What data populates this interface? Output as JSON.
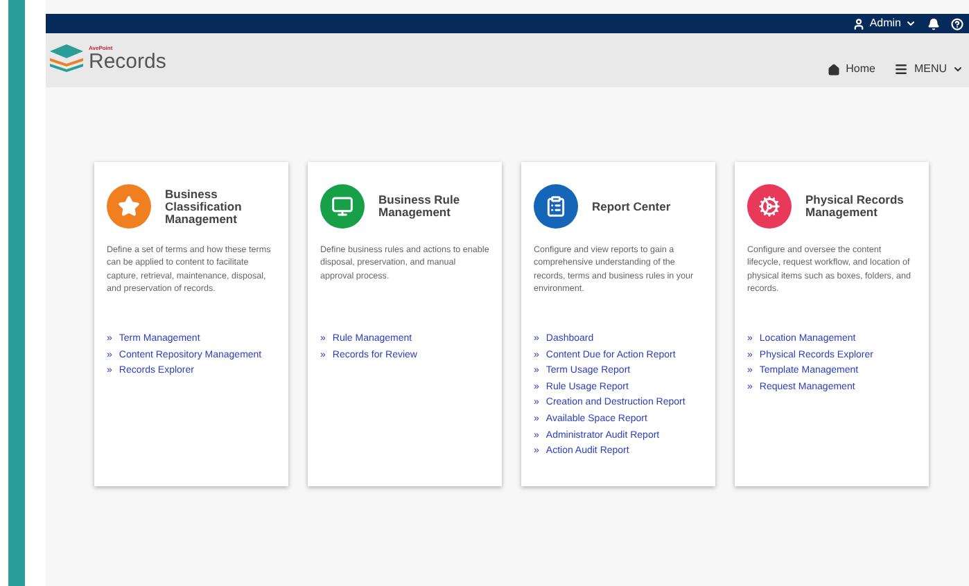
{
  "top_bar": {
    "user": "Admin"
  },
  "header": {
    "brand": "AvePoint",
    "product": "Records",
    "nav": [
      {
        "label": "Home"
      },
      {
        "label": "MENU"
      }
    ]
  },
  "cards": [
    {
      "title": "Business Classification Management",
      "color": "#f07f22",
      "description": "Define a set of terms and how these terms can be applied to content to facilitate capture, retrieval, maintenance, disposal, and preservation of records.",
      "links": [
        {
          "marker": "»",
          "label": "Term Management"
        },
        {
          "marker": "»",
          "label": "Content Repository Management"
        },
        {
          "marker": "»",
          "label": "Records Explorer"
        }
      ]
    },
    {
      "title": "Business Rule Management",
      "color": "#18a048",
      "description": "Define business rules and actions to enable disposal, preservation, and manual approval process.",
      "links": [
        {
          "marker": "»",
          "label": "Rule Management"
        },
        {
          "marker": "»",
          "label": "Records for Review"
        }
      ]
    },
    {
      "title": "Report Center",
      "color": "#1565b8",
      "description": "Configure and view reports to gain a comprehensive understanding of the records, terms and business rules in your environment.",
      "links": [
        {
          "marker": "»",
          "label": "Dashboard"
        },
        {
          "marker": "»",
          "label": "Content Due for Action Report"
        },
        {
          "marker": "»",
          "label": "Term Usage Report"
        },
        {
          "marker": "»",
          "label": "Rule Usage Report"
        },
        {
          "marker": "»",
          "label": "Creation and Destruction Report"
        },
        {
          "marker": "»",
          "label": "Available Space Report"
        },
        {
          "marker": "»",
          "label": "Administrator Audit Report"
        },
        {
          "marker": "»",
          "label": "Action Audit Report"
        }
      ]
    },
    {
      "title": "Physical Records Management",
      "color": "#e8395a",
      "description": "Configure and oversee the content lifecycle, request workflow, and location of physical items such as boxes, folders, and records.",
      "links": [
        {
          "marker": "»",
          "label": "Location Management"
        },
        {
          "marker": "»",
          "label": "Physical Records Explorer"
        },
        {
          "marker": "»",
          "label": "Template Management"
        },
        {
          "marker": "»",
          "label": "Request Management"
        }
      ]
    }
  ]
}
